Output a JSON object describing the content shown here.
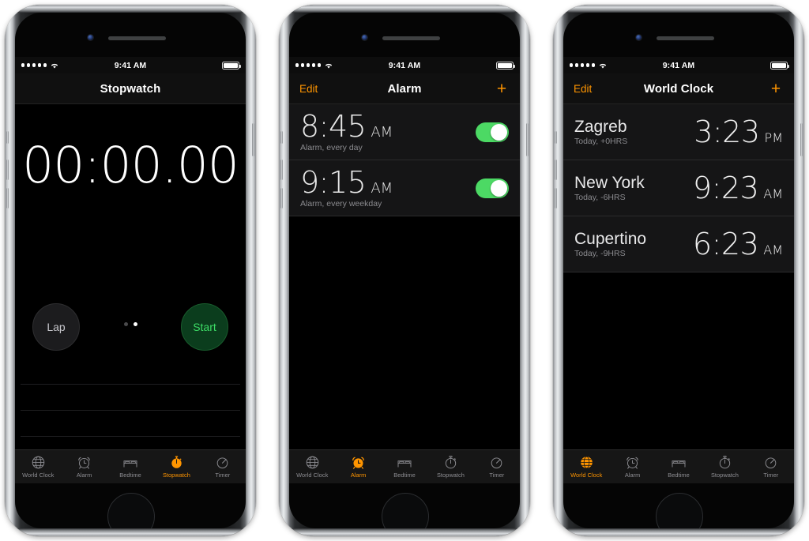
{
  "accent": {
    "orange": "#ff9500",
    "green_toggle": "#4cd964",
    "green_text": "#3ddc66",
    "screen_bg": "#000000",
    "row_bg": "#151516"
  },
  "status_bar": {
    "signal_dots": 5,
    "wifi_icon": "wifi-icon",
    "time": "9:41 AM",
    "battery_icon": "battery-full-icon"
  },
  "tabs": [
    {
      "label": "World Clock",
      "icon": "globe-icon"
    },
    {
      "label": "Alarm",
      "icon": "alarm-clock-icon"
    },
    {
      "label": "Bedtime",
      "icon": "bed-icon"
    },
    {
      "label": "Stopwatch",
      "icon": "stopwatch-icon"
    },
    {
      "label": "Timer",
      "icon": "timer-icon"
    }
  ],
  "phones": [
    {
      "id": "stopwatch",
      "nav": {
        "title": "Stopwatch",
        "edit_label": "",
        "plus_label": ""
      },
      "active_tab": "Stopwatch",
      "stopwatch": {
        "display": "00:00.00",
        "lap_label": "Lap",
        "start_label": "Start",
        "page_dots": 2,
        "active_dot": 2,
        "empty_lap_rows": 4
      }
    },
    {
      "id": "alarm",
      "nav": {
        "title": "Alarm",
        "edit_label": "Edit",
        "plus_label": "+"
      },
      "active_tab": "Alarm",
      "alarms": [
        {
          "time": "8:45",
          "meridiem": "AM",
          "subtitle": "Alarm, every day",
          "enabled": true
        },
        {
          "time": "9:15",
          "meridiem": "AM",
          "subtitle": "Alarm, every weekday",
          "enabled": true
        }
      ]
    },
    {
      "id": "world-clock",
      "nav": {
        "title": "World Clock",
        "edit_label": "Edit",
        "plus_label": "+"
      },
      "active_tab": "World Clock",
      "cities": [
        {
          "city": "Zagreb",
          "subtitle": "Today, +0HRS",
          "time": "3:23",
          "meridiem": "PM"
        },
        {
          "city": "New York",
          "subtitle": "Today, -6HRS",
          "time": "9:23",
          "meridiem": "AM"
        },
        {
          "city": "Cupertino",
          "subtitle": "Today, -9HRS",
          "time": "6:23",
          "meridiem": "AM"
        }
      ]
    }
  ]
}
